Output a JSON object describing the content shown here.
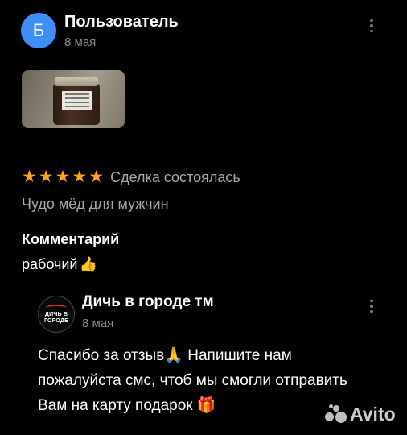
{
  "review": {
    "author": {
      "initial": "Б",
      "name": "Пользователь",
      "date": "8 мая",
      "avatar_color": "#3f8ef5"
    },
    "rating": {
      "stars": 5,
      "max": 5,
      "star_color": "#ffa41b"
    },
    "deal_status": "Сделка состоялась",
    "product_name": "Чудо мёд для мужчин",
    "comment_heading": "Комментарий",
    "comment_text": "рабочий",
    "comment_emoji": "👍"
  },
  "seller_reply": {
    "logo_text": "ДИЧЬ В ГОРОДЕ",
    "name": "Дичь в городе тм",
    "date": "8 мая",
    "text_part1": "Спасибо за отзыв",
    "emoji_pray": "🙏",
    "text_part2": " Напишите нам пожалуйста смс, чтоб мы смогли отправить Вам на карту подарок ",
    "emoji_gift": "🎁"
  },
  "watermark": {
    "text": "Avito"
  }
}
